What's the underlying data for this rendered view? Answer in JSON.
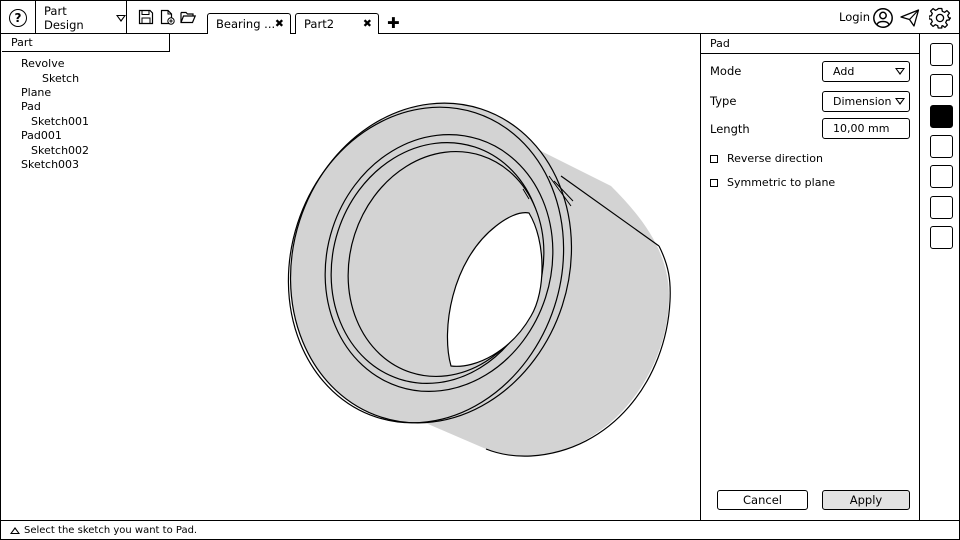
{
  "toolbar": {
    "help_icon": "question-mark-icon",
    "help_glyph": "?",
    "workbench": "Part Design",
    "icons": [
      "save-icon",
      "new-document-icon",
      "open-folder-icon"
    ]
  },
  "tabs": [
    {
      "label": "Bearing ...",
      "close": "✖"
    },
    {
      "label": "Part2",
      "close": "✖"
    }
  ],
  "tab_add": "✚",
  "account": {
    "login_label": "Login",
    "user_icon": "user-circle-icon",
    "send_icon": "paper-plane-icon",
    "settings_icon": "gear-icon"
  },
  "tree": {
    "header": "Part",
    "items": [
      "Revolve",
      "Sketch",
      "Plane",
      "Pad",
      "Sketch001",
      "Pad001",
      "Sketch002",
      "Sketch003"
    ]
  },
  "panel": {
    "title": "Pad",
    "mode_label": "Mode",
    "mode_value": "Add",
    "type_label": "Type",
    "type_value": "Dimension",
    "length_label": "Length",
    "length_value": "10,00 mm",
    "reverse_label": "Reverse direction",
    "symmetric_label": "Symmetric to plane",
    "cancel_label": "Cancel",
    "apply_label": "Apply"
  },
  "right_toolbar": {
    "active_index": 2,
    "count": 7
  },
  "status": {
    "icon": "triangle-up-icon",
    "text": "Select the sketch you want to Pad."
  },
  "colors": {
    "model_fill": "#d3d3d3",
    "active_button": "#000000"
  }
}
